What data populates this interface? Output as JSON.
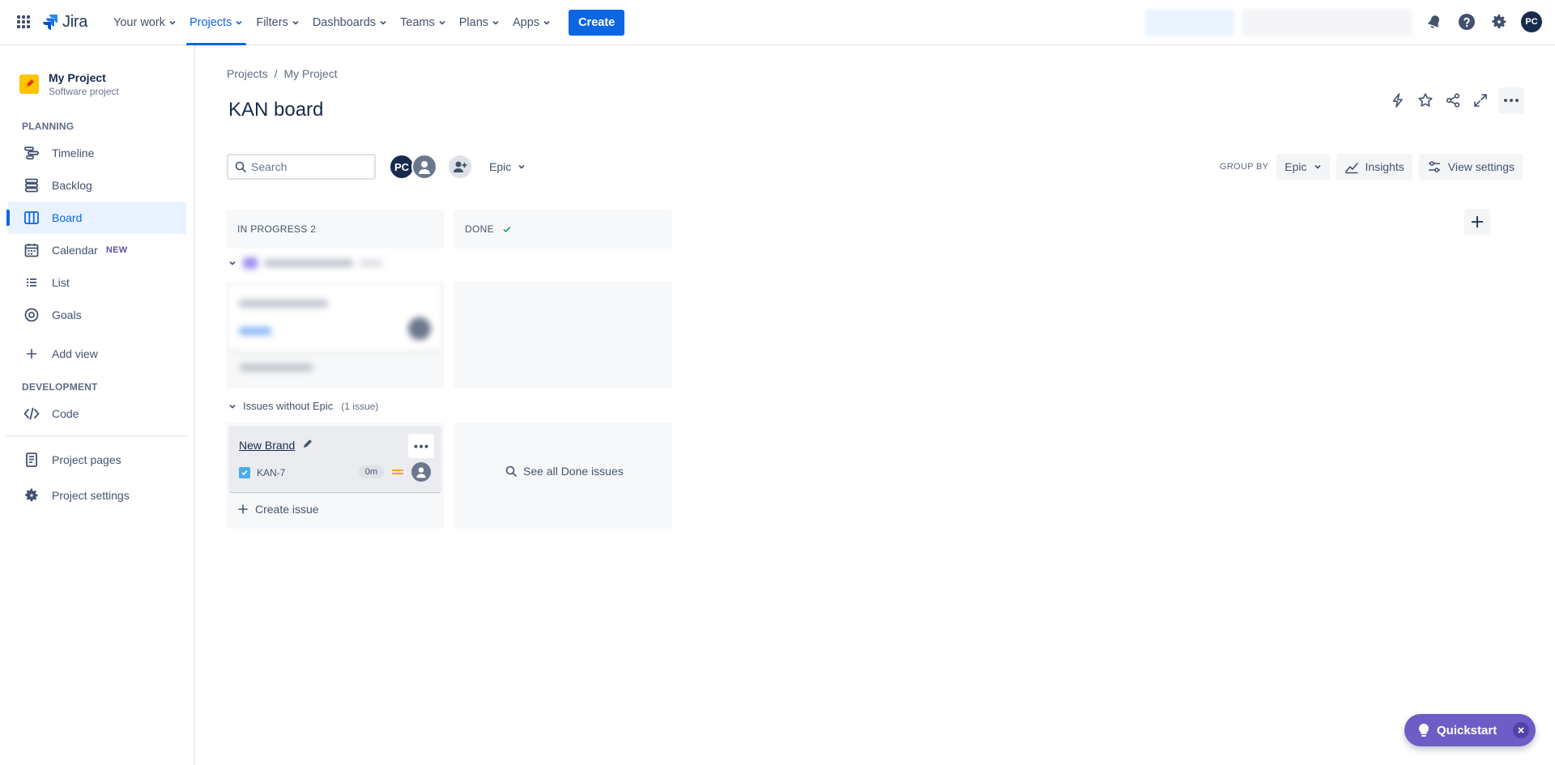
{
  "topnav": {
    "logo_text": "Jira",
    "items": [
      {
        "label": "Your work"
      },
      {
        "label": "Projects"
      },
      {
        "label": "Filters"
      },
      {
        "label": "Dashboards"
      },
      {
        "label": "Teams"
      },
      {
        "label": "Plans"
      },
      {
        "label": "Apps"
      }
    ],
    "create_label": "Create",
    "avatar_initials": "PC"
  },
  "sidebar": {
    "project_name": "My Project",
    "project_type": "Software project",
    "planning_label": "PLANNING",
    "development_label": "DEVELOPMENT",
    "items": {
      "timeline": "Timeline",
      "backlog": "Backlog",
      "board": "Board",
      "calendar": "Calendar",
      "calendar_badge": "NEW",
      "list": "List",
      "goals": "Goals",
      "add_view": "Add view",
      "code": "Code",
      "project_pages": "Project pages",
      "project_settings": "Project settings"
    }
  },
  "breadcrumb": {
    "root": "Projects",
    "sep": "/",
    "current": "My Project"
  },
  "page_title": "KAN board",
  "toolbar": {
    "search_placeholder": "Search",
    "avatar_initials": "PC",
    "epic_filter": "Epic",
    "group_by_label": "GROUP BY",
    "group_by_value": "Epic",
    "insights": "Insights",
    "view_settings": "View settings"
  },
  "board": {
    "columns": [
      {
        "title": "IN PROGRESS 2"
      },
      {
        "title": "DONE"
      }
    ],
    "swimlane_no_epic": {
      "title": "Issues without Epic",
      "count": "(1 issue)"
    },
    "card": {
      "title": "New Brand",
      "key": "KAN-7",
      "estimate": "0m"
    },
    "create_issue": "Create issue",
    "see_all_done": "See all Done issues"
  },
  "quickstart": {
    "label": "Quickstart"
  },
  "colors": {
    "accent": "#0c66e4",
    "quickstart": "#6e5dc6",
    "project_icon": "#ffc400",
    "done_check": "#22a06b"
  }
}
